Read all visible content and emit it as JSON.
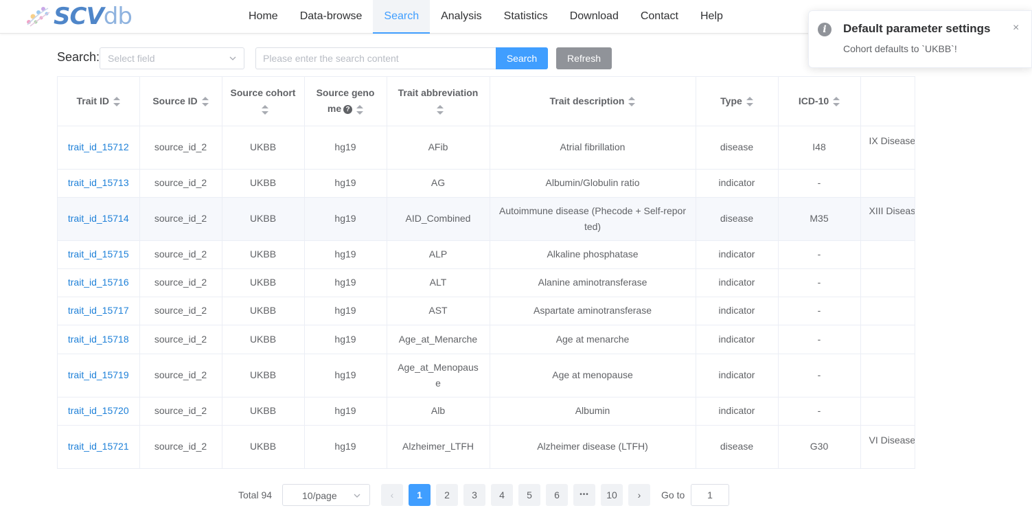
{
  "brand": {
    "logo_main": "SCV",
    "logo_suffix": "db"
  },
  "nav": {
    "items": [
      {
        "label": "Home"
      },
      {
        "label": "Data-browse"
      },
      {
        "label": "Search"
      },
      {
        "label": "Analysis"
      },
      {
        "label": "Statistics"
      },
      {
        "label": "Download"
      },
      {
        "label": "Contact"
      },
      {
        "label": "Help"
      }
    ],
    "active": "Search"
  },
  "search": {
    "label": "Search:",
    "field_placeholder": "Select field",
    "content_placeholder": "Please enter the search content",
    "search_button": "Search",
    "refresh_button": "Refresh"
  },
  "table": {
    "columns": [
      "Trait ID",
      "Source ID",
      "Source cohort",
      "Source geno me",
      "Trait abbreviation",
      "Trait description",
      "Type",
      "ICD-10",
      ""
    ],
    "rows": [
      {
        "trait_id": "trait_id_15712",
        "source_id": "source_id_2",
        "cohort": "UKBB",
        "genome": "hg19",
        "abbr": "AFib",
        "desc": "Atrial fibrillation",
        "type": "disease",
        "icd10": "I48",
        "extra": "IX Disease"
      },
      {
        "trait_id": "trait_id_15713",
        "source_id": "source_id_2",
        "cohort": "UKBB",
        "genome": "hg19",
        "abbr": "AG",
        "desc": "Albumin/Globulin ratio",
        "type": "indicator",
        "icd10": "-",
        "extra": ""
      },
      {
        "trait_id": "trait_id_15714",
        "source_id": "source_id_2",
        "cohort": "UKBB",
        "genome": "hg19",
        "abbr": "AID_Combined",
        "desc": "Autoimmune disease (Phecode + Self-repor ted)",
        "type": "disease",
        "icd10": "M35",
        "extra": "XIII Diseas and c"
      },
      {
        "trait_id": "trait_id_15715",
        "source_id": "source_id_2",
        "cohort": "UKBB",
        "genome": "hg19",
        "abbr": "ALP",
        "desc": "Alkaline phosphatase",
        "type": "indicator",
        "icd10": "-",
        "extra": ""
      },
      {
        "trait_id": "trait_id_15716",
        "source_id": "source_id_2",
        "cohort": "UKBB",
        "genome": "hg19",
        "abbr": "ALT",
        "desc": "Alanine aminotransferase",
        "type": "indicator",
        "icd10": "-",
        "extra": ""
      },
      {
        "trait_id": "trait_id_15717",
        "source_id": "source_id_2",
        "cohort": "UKBB",
        "genome": "hg19",
        "abbr": "AST",
        "desc": "Aspartate aminotransferase",
        "type": "indicator",
        "icd10": "-",
        "extra": ""
      },
      {
        "trait_id": "trait_id_15718",
        "source_id": "source_id_2",
        "cohort": "UKBB",
        "genome": "hg19",
        "abbr": "Age_at_Menarche",
        "desc": "Age at menarche",
        "type": "indicator",
        "icd10": "-",
        "extra": ""
      },
      {
        "trait_id": "trait_id_15719",
        "source_id": "source_id_2",
        "cohort": "UKBB",
        "genome": "hg19",
        "abbr": "Age_at_Menopaus e",
        "desc": "Age at menopause",
        "type": "indicator",
        "icd10": "-",
        "extra": ""
      },
      {
        "trait_id": "trait_id_15720",
        "source_id": "source_id_2",
        "cohort": "UKBB",
        "genome": "hg19",
        "abbr": "Alb",
        "desc": "Albumin",
        "type": "indicator",
        "icd10": "-",
        "extra": ""
      },
      {
        "trait_id": "trait_id_15721",
        "source_id": "source_id_2",
        "cohort": "UKBB",
        "genome": "hg19",
        "abbr": "Alzheimer_LTFH",
        "desc": "Alzheimer disease (LTFH)",
        "type": "disease",
        "icd10": "G30",
        "extra": "VI Disease"
      }
    ]
  },
  "pagination": {
    "total": "Total 94",
    "page_size": "10/page",
    "prev": "‹",
    "next": "›",
    "pages": [
      "1",
      "2",
      "3",
      "4",
      "5",
      "6",
      "•••",
      "10"
    ],
    "current": "1",
    "goto_label": "Go to",
    "goto_value": "1"
  },
  "notification": {
    "icon": "i",
    "title": "Default parameter settings",
    "message": "Cohort defaults to `UKBB`!",
    "close": "×"
  },
  "colors": {
    "accent": "#409eff",
    "link": "#1e80d8",
    "refresh": "#909399"
  }
}
